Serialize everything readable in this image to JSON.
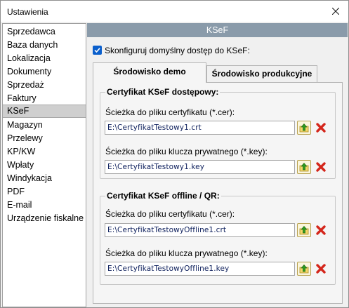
{
  "window": {
    "title": "Ustawienia"
  },
  "sidebar": {
    "items": [
      {
        "label": "Sprzedawca"
      },
      {
        "label": "Baza danych"
      },
      {
        "label": "Lokalizacja"
      },
      {
        "label": "Dokumenty"
      },
      {
        "label": "Sprzedaż"
      },
      {
        "label": "Faktury"
      },
      {
        "label": "KSeF",
        "selected": true
      },
      {
        "label": "Magazyn"
      },
      {
        "label": "Przelewy"
      },
      {
        "label": "KP/KW"
      },
      {
        "label": "Wpłaty"
      },
      {
        "label": "Windykacja"
      },
      {
        "label": "PDF"
      },
      {
        "label": "E-mail"
      },
      {
        "label": "Urządzenie fiskalne"
      }
    ]
  },
  "panel": {
    "header": "KSeF",
    "configure_checkbox": {
      "label": "Skonfiguruj domyślny dostęp do KSeF:",
      "checked": true
    },
    "tabs": [
      {
        "label": "Środowisko demo",
        "active": true
      },
      {
        "label": "Środowisko produkcyjne",
        "active": false
      }
    ],
    "groups": [
      {
        "title": "Certyfikat KSeF dostępowy:",
        "cert_label": "Ścieżka do pliku certyfikatu (*.cer):",
        "cert_value": "E:\\CertyfikatTestowy1.crt",
        "key_label": "Ścieżka do pliku klucza prywatnego (*.key):",
        "key_value": "E:\\CertyfikatTestowy1.key"
      },
      {
        "title": "Certyfikat KSeF offline / QR:",
        "cert_label": "Ścieżka do pliku certyfikatu (*.cer):",
        "cert_value": "E:\\CertyfikatTestowyOffline1.crt",
        "key_label": "Ścieżka do pliku klucza prywatnego (*.key):",
        "key_value": "E:\\CertyfikatTestowyOffline1.key"
      }
    ]
  },
  "icons": {
    "close": "close-icon",
    "checkmark": "checkmark-icon",
    "browse": "folder-up-arrow-icon",
    "clear": "red-x-icon"
  },
  "colors": {
    "header_bg": "#8a9baa",
    "selected_item_bg": "#cfcfcf",
    "checkbox_accent": "#0a5fcc",
    "path_text": "#0d1f5c",
    "clear_red": "#d4261b",
    "browse_green": "#2e9b1f"
  }
}
